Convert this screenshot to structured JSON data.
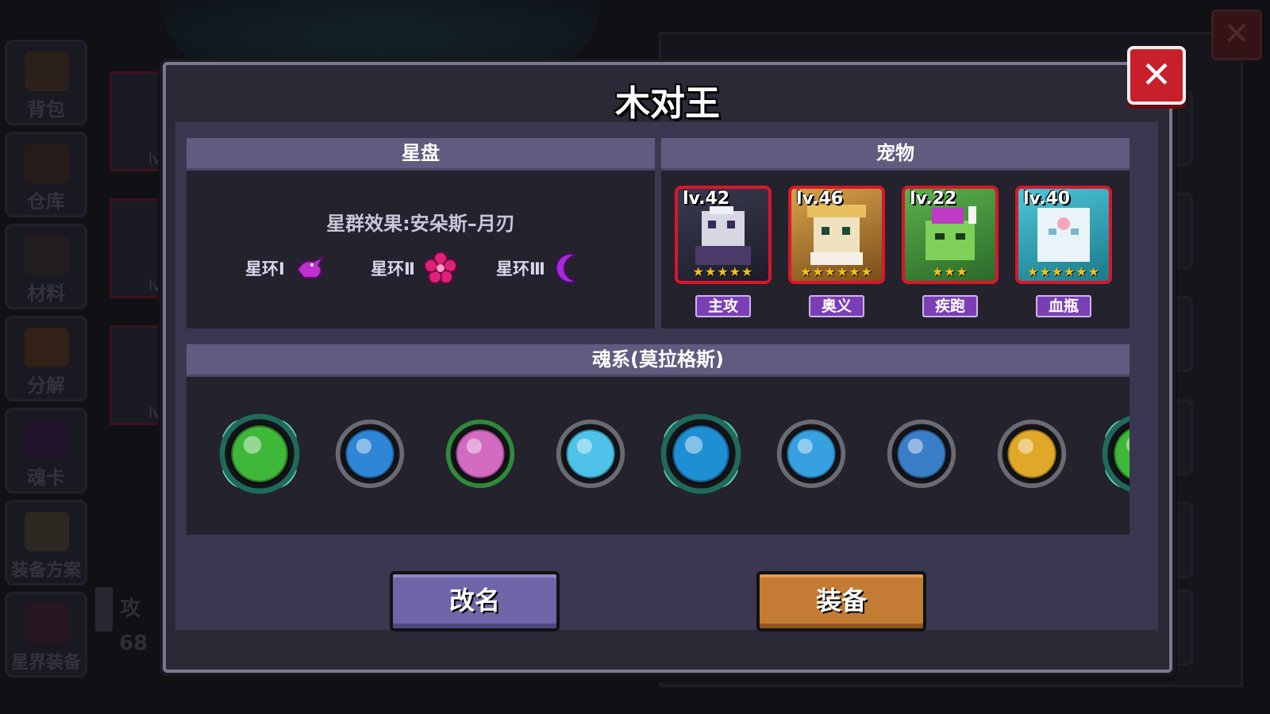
{
  "background": {
    "sidebar": [
      "背包",
      "仓库",
      "材料",
      "分解",
      "魂卡",
      "装备方案",
      "星界装备"
    ],
    "card_levels": [
      "lv.",
      "lv.",
      "lv."
    ],
    "stat_label": "攻",
    "stat_value": "68"
  },
  "dialog": {
    "title": "木对王",
    "close_glyph": "✕"
  },
  "star_disk": {
    "header": "星盘",
    "effect": "星群效果:安朵斯–月刃",
    "rings": [
      {
        "label": "星环Ⅰ",
        "icon": "bird-icon",
        "color": "#c02fd0"
      },
      {
        "label": "星环Ⅱ",
        "icon": "flower-icon",
        "color": "#e0207a"
      },
      {
        "label": "星环Ⅲ",
        "icon": "crescent-icon",
        "color": "#a829d8"
      }
    ]
  },
  "pets": {
    "header": "宠物",
    "items": [
      {
        "level": "lv.42",
        "stars": 5,
        "tag": "主攻",
        "bg": "#2a2a3a",
        "accent": "#d7d7e4"
      },
      {
        "level": "lv.46",
        "stars": 6,
        "tag": "奥义",
        "bg": "#b0803a",
        "accent": "#f0e2c0"
      },
      {
        "level": "lv.22",
        "stars": 3,
        "tag": "疾跑",
        "bg": "#3f8a3a",
        "accent": "#7ed058"
      },
      {
        "level": "lv.40",
        "stars": 6,
        "tag": "血瓶",
        "bg": "#3aa7b8",
        "accent": "#e8f4f8"
      }
    ]
  },
  "soul": {
    "header": "魂系(莫拉格斯)",
    "items": [
      {
        "icon": "green-orb-icon",
        "color": "#3fb83a"
      },
      {
        "icon": "blue-orb-icon",
        "color": "#2e86d6"
      },
      {
        "icon": "pink-orb-icon",
        "color": "#d46bc2"
      },
      {
        "icon": "crystal-orb-icon",
        "color": "#4ec2e8"
      },
      {
        "icon": "leaf-orb-icon",
        "color": "#1f8fd4"
      },
      {
        "icon": "scroll-orb-icon",
        "color": "#36a0e0"
      },
      {
        "icon": "cat-orb-icon",
        "color": "#3a7ec8"
      },
      {
        "icon": "gold-orb-icon",
        "color": "#e0a828"
      },
      {
        "icon": "green-orb-icon",
        "color": "#3fb83a"
      }
    ]
  },
  "buttons": {
    "rename": "改名",
    "equip": "装备"
  },
  "colors": {
    "rename": "#6e66a8",
    "equip": "#c47c34",
    "accent_red": "#d9162a"
  }
}
